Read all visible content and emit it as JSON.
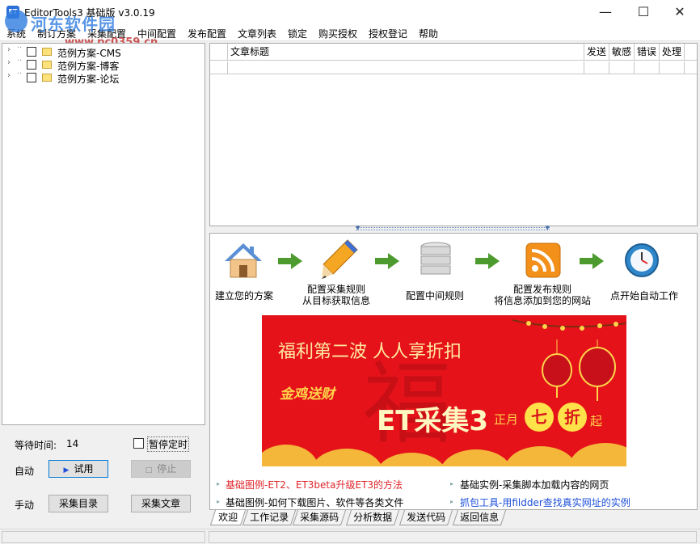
{
  "window": {
    "title": "EditorTools3 基础版 v3.0.19",
    "app_icon_text": "ET",
    "minimize": "—",
    "maximize": "☐",
    "close": "✕"
  },
  "watermark": {
    "line1": "河东软件园",
    "line2": "www.pc0359.cn"
  },
  "menu": [
    "系统",
    "制订方案",
    "采集配置",
    "中间配置",
    "发布配置",
    "文章列表",
    "锁定",
    "购买授权",
    "授权登记",
    "帮助"
  ],
  "tree": {
    "items": [
      {
        "label": "范例方案-CMS"
      },
      {
        "label": "范例方案-博客"
      },
      {
        "label": "范例方案-论坛"
      }
    ]
  },
  "controls": {
    "wait_label": "等待时间:",
    "wait_value": "14",
    "pause_timer_label": "暂停定时",
    "auto_label": "自动",
    "trial_button": "试用",
    "stop_button": "停止",
    "manual_label": "手动",
    "collect_list_button": "采集目录",
    "collect_article_button": "采集文章"
  },
  "grid": {
    "columns": [
      "文章标题",
      "发送",
      "敏感",
      "错误",
      "处理"
    ]
  },
  "welcome": {
    "steps": [
      {
        "icon": "home-icon",
        "label": "建立您的方案"
      },
      {
        "icon": "pencil-icon",
        "label_line1": "配置采集规则",
        "label_line2": "从目标获取信息"
      },
      {
        "icon": "database-icon",
        "label": "配置中间规则"
      },
      {
        "icon": "rss-icon",
        "label_line1": "配置发布规则",
        "label_line2": "将信息添加到您的网站"
      },
      {
        "icon": "clock-icon",
        "label": "点开始自动工作"
      }
    ],
    "banner": {
      "title": "福利第二波 人人享折扣",
      "script_text": "金鸡送财",
      "main": "ET采集3",
      "month": "正月",
      "discount1": "七",
      "discount2": "折",
      "suffix": "起",
      "bg_char": "福"
    },
    "links": [
      {
        "text": "基础图例-ET2、ET3beta升级ET3的方法",
        "color": "#e0242a"
      },
      {
        "text": "基础实例-采集脚本加载内容的网页",
        "color": "#000000"
      },
      {
        "text": "基础图例-如何下载图片、软件等各类文件",
        "color": "#000000"
      },
      {
        "text": "抓包工具-用fildder查找真实网址的实例",
        "color": "#1d4fd8"
      }
    ]
  },
  "tabs": [
    "欢迎",
    "工作记录",
    "采集源码",
    "分析数据",
    "发送代码",
    "返回信息"
  ]
}
